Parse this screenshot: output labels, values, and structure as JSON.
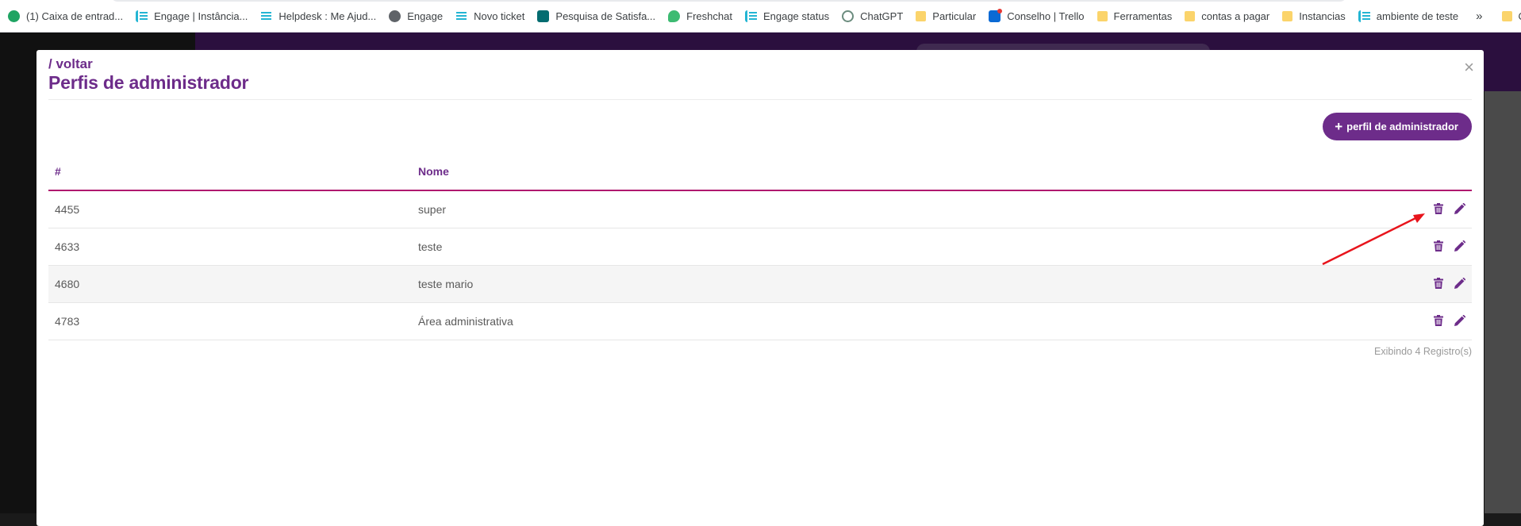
{
  "bookmarks": [
    {
      "label": "(1) Caixa de entrad...",
      "icon": "green"
    },
    {
      "label": "Engage | Instância...",
      "icon": "engage"
    },
    {
      "label": "Helpdesk : Me Ajud...",
      "icon": "dots"
    },
    {
      "label": "Engage",
      "icon": "globe"
    },
    {
      "label": "Novo ticket",
      "icon": "dots"
    },
    {
      "label": "Pesquisa de Satisfa...",
      "icon": "forms"
    },
    {
      "label": "Freshchat",
      "icon": "fresh"
    },
    {
      "label": "Engage status",
      "icon": "engage"
    },
    {
      "label": "ChatGPT",
      "icon": "gpt"
    },
    {
      "label": "Particular",
      "icon": "folder"
    },
    {
      "label": "Conselho | Trello",
      "icon": "trello"
    },
    {
      "label": "Ferramentas",
      "icon": "folder"
    },
    {
      "label": "contas a pagar",
      "icon": "folder"
    },
    {
      "label": "Instancias",
      "icon": "folder"
    },
    {
      "label": "ambiente de teste",
      "icon": "engage"
    }
  ],
  "bookmarks_more": "»",
  "bookmarks_other": "Outros favoritos",
  "modal": {
    "back_label": "/ voltar",
    "title": "Perfis de administrador",
    "close_label": "×",
    "add_button_plus": "+",
    "add_button_label": "perfil de administrador",
    "columns": {
      "id": "#",
      "name": "Nome"
    },
    "rows": [
      {
        "id": "4455",
        "name": "super"
      },
      {
        "id": "4633",
        "name": "teste"
      },
      {
        "id": "4680",
        "name": "teste mario"
      },
      {
        "id": "4783",
        "name": "Área administrativa"
      }
    ],
    "records_label": "Exibindo 4 Registro(s)"
  },
  "colors": {
    "brand_purple": "#6d2c8a",
    "header_underline": "#b0186e",
    "annotation_arrow": "#e8141c"
  },
  "icons": [
    "trash-icon",
    "pencil-icon",
    "close-icon",
    "plus-icon"
  ]
}
